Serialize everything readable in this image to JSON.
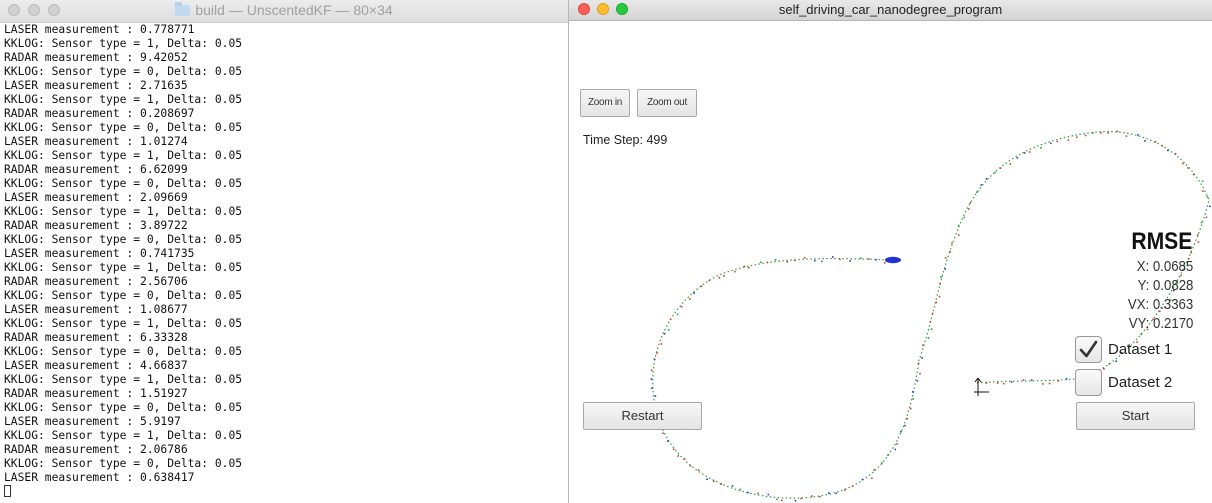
{
  "terminal": {
    "title": "build — UnscentedKF — 80×34",
    "lines": [
      "LASER measurement : 0.778771",
      "KKLOG: Sensor type = 1, Delta: 0.05",
      "RADAR measurement : 9.42052",
      "KKLOG: Sensor type = 0, Delta: 0.05",
      "LASER measurement : 2.71635",
      "KKLOG: Sensor type = 1, Delta: 0.05",
      "RADAR measurement : 0.208697",
      "KKLOG: Sensor type = 0, Delta: 0.05",
      "LASER measurement : 1.01274",
      "KKLOG: Sensor type = 1, Delta: 0.05",
      "RADAR measurement : 6.62099",
      "KKLOG: Sensor type = 0, Delta: 0.05",
      "LASER measurement : 2.09669",
      "KKLOG: Sensor type = 1, Delta: 0.05",
      "RADAR measurement : 3.89722",
      "KKLOG: Sensor type = 0, Delta: 0.05",
      "LASER measurement : 0.741735",
      "KKLOG: Sensor type = 1, Delta: 0.05",
      "RADAR measurement : 2.56706",
      "KKLOG: Sensor type = 0, Delta: 0.05",
      "LASER measurement : 1.08677",
      "KKLOG: Sensor type = 1, Delta: 0.05",
      "RADAR measurement : 6.33328",
      "KKLOG: Sensor type = 0, Delta: 0.05",
      "LASER measurement : 4.66837",
      "KKLOG: Sensor type = 1, Delta: 0.05",
      "RADAR measurement : 1.51927",
      "KKLOG: Sensor type = 0, Delta: 0.05",
      "LASER measurement : 5.9197",
      "KKLOG: Sensor type = 1, Delta: 0.05",
      "RADAR measurement : 2.06786",
      "KKLOG: Sensor type = 0, Delta: 0.05",
      "LASER measurement : 0.638417"
    ]
  },
  "simulator": {
    "title": "self_driving_car_nanodegree_program",
    "zoom_in_label": "Zoom in",
    "zoom_out_label": "Zoom out",
    "time_step_label": "Time Step: 499",
    "rmse": {
      "title": "RMSE",
      "x": "X: 0.0685",
      "y": "Y: 0.0828",
      "vx": "VX: 0.3363",
      "vy": "VY: 0.2170"
    },
    "dataset1_label": "Dataset 1",
    "dataset1_checked": true,
    "dataset2_label": "Dataset 2",
    "dataset2_checked": false,
    "restart_label": "Restart",
    "start_label": "Start",
    "colors": {
      "track_green": "#2e9e3e",
      "lidar_red": "#d23c3c",
      "radar_blue": "#2a3fd0",
      "car_blue": "#2233cc"
    }
  }
}
